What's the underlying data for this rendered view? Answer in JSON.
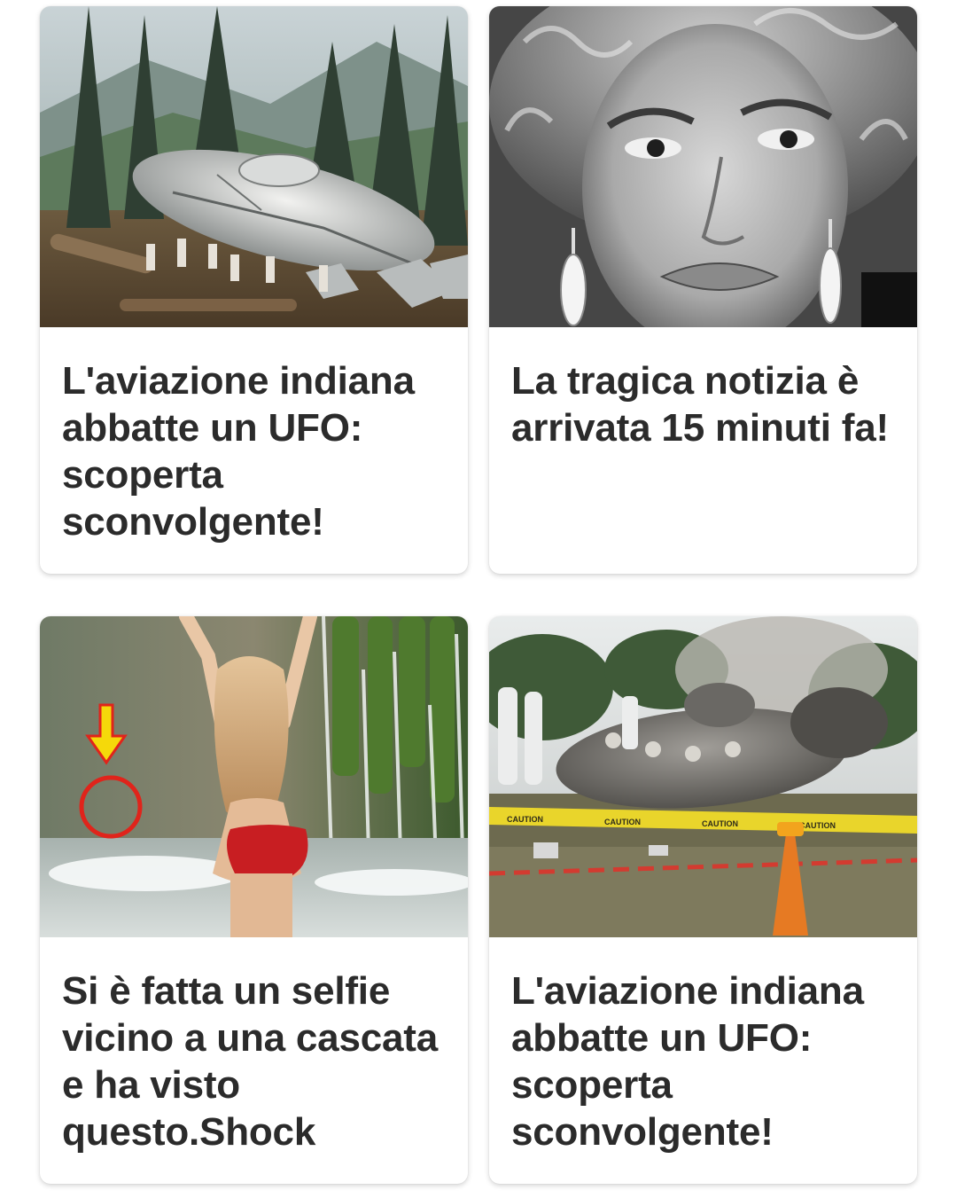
{
  "cards": [
    {
      "headline": "L'aviazione indiana abbatte un UFO: scoperta sconvolgente!",
      "image": "crashed-ufo-forest-photo"
    },
    {
      "headline": "La tragica notizia è arrivata 15 minuti fa!",
      "image": "woman-portrait-bw-photo"
    },
    {
      "headline": "Si è fatta un selfie vicino a una cascata e ha visto questo.Shock",
      "image": "waterfall-selfie-photo"
    },
    {
      "headline": "L'aviazione indiana abbatte un UFO: scoperta sconvolgente!",
      "image": "ufo-crash-site-caution-tape-photo"
    }
  ],
  "colors": {
    "headline_text": "#2b2b2b",
    "card_background": "#ffffff",
    "annotation_red": "#e0241b",
    "arrow_yellow": "#f5d90a"
  }
}
